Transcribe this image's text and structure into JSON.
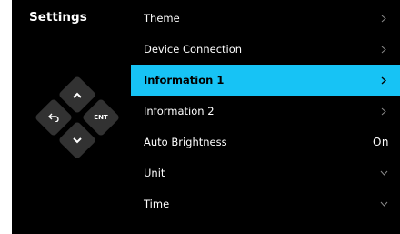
{
  "screen": {
    "title": "Settings"
  },
  "dpad": {
    "enter_label": "ENT",
    "up_icon": "chevron-up-icon",
    "down_icon": "chevron-down-icon",
    "back_icon": "back-arrow-icon"
  },
  "menu": {
    "items": [
      {
        "label": "Theme",
        "indicator": "chevron-right-icon",
        "selected": false
      },
      {
        "label": "Device Connection",
        "indicator": "chevron-right-icon",
        "selected": false
      },
      {
        "label": "Information 1",
        "indicator": "chevron-right-icon",
        "selected": true
      },
      {
        "label": "Information 2",
        "indicator": "chevron-right-icon",
        "selected": false
      },
      {
        "label": "Auto Brightness",
        "value": "On",
        "selected": false
      },
      {
        "label": "Unit",
        "indicator": "chevron-down-icon",
        "selected": false
      },
      {
        "label": "Time",
        "indicator": "chevron-down-icon",
        "selected": false
      }
    ]
  },
  "colors": {
    "background": "#000000",
    "selected_row": "#17c3f5",
    "key_fill": "#323232",
    "text": "#ffffff",
    "chevron": "#8a8a8a"
  }
}
